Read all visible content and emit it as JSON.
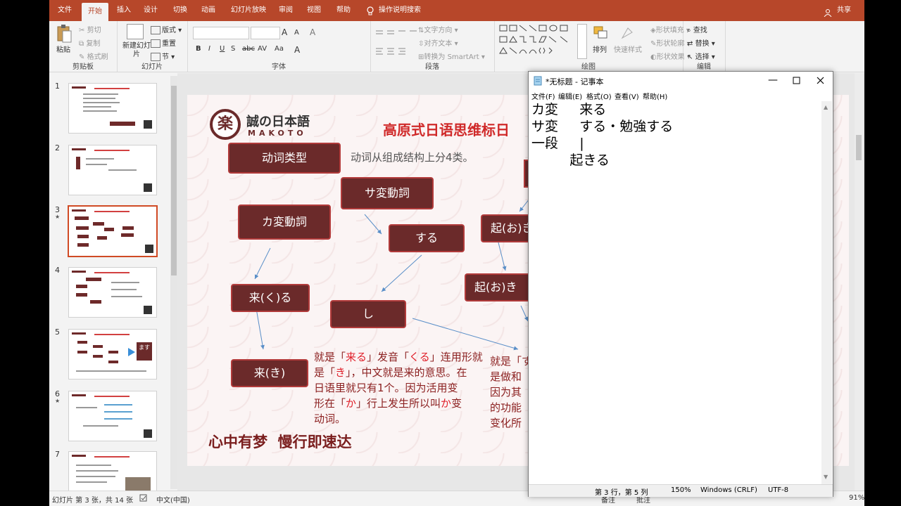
{
  "ppt": {
    "tabs": [
      "文件",
      "开始",
      "插入",
      "设计",
      "切换",
      "动画",
      "幻灯片放映",
      "审阅",
      "视图",
      "帮助"
    ],
    "active_tab": "开始",
    "tell_me": "操作说明搜索",
    "share": "共享",
    "groups": {
      "clipboard": {
        "label": "剪贴板",
        "paste": "粘贴",
        "cut": "剪切",
        "copy": "复制",
        "painter": "格式刷"
      },
      "slides": {
        "label": "幻灯片",
        "new": "新建幻灯片",
        "layout": "版式",
        "reset": "重置",
        "section": "节"
      },
      "font": {
        "label": "字体",
        "bold": "B",
        "italic": "I",
        "underline": "U",
        "strike": "S",
        "abc": "abc",
        "av": "AV",
        "aa": "Aa",
        "grow": "A",
        "shrink": "A",
        "clear": "A"
      },
      "paragraph": {
        "label": "段落",
        "text_direction": "文字方向",
        "align_text": "对齐文本",
        "smartart": "转换为 SmartArt"
      },
      "drawing": {
        "label": "绘图",
        "arrange": "排列",
        "quick_styles": "快速样式",
        "fill": "形状填充",
        "outline": "形状轮廓",
        "effects": "形状效果"
      },
      "editing": {
        "label": "编辑",
        "find": "查找",
        "replace": "替换",
        "select": "选择"
      }
    },
    "thumb_numbers": [
      "1",
      "2",
      "3",
      "4",
      "5",
      "6",
      "7"
    ],
    "thumb_star_5": "★",
    "thumb_star_6": "★",
    "thumb_5_badge": "ます",
    "status": {
      "slide": "幻灯片 第 3 张，共 14 张",
      "lang": "中文(中国)",
      "notes": "备注",
      "comments": "批注",
      "zoom": "91%"
    }
  },
  "slide": {
    "logo_glyph": "楽",
    "logo_text": "誠の日本語",
    "logo_sub": "MAKOTO",
    "title": "高原式日语思维标日",
    "intro": "动词从组成结构上分4类。",
    "boxes": {
      "type": "动词类型",
      "sa": "サ変動詞",
      "ka": "カ変動詞",
      "suru": "する",
      "oki_o": "起(お)き",
      "kuru": "来(く)る",
      "shi": "し",
      "oki_oki": "起(お)き",
      "ki": "来(き)"
    },
    "note_left": [
      "就是「",
      "来る",
      "」发音「",
      "くる",
      "」连用形就",
      "是「",
      "き",
      "」，中文就是来的意思。在",
      "日语里就只有1个。因为活用变",
      "形在「",
      "か",
      "」行上发生所以叫",
      "か",
      "变",
      "动词。"
    ],
    "note_right": [
      "就是「す",
      "是做和",
      "因为其",
      "的功能",
      "变化所"
    ],
    "slogan": "心中有梦  慢行即速达"
  },
  "notepad": {
    "title": "*无标题 - 记事本",
    "menu": [
      "文件(F)",
      "编辑(E)",
      "格式(O)",
      "查看(V)",
      "帮助(H)"
    ],
    "lines": [
      "カ変     来る",
      "サ変     する・勉強する",
      "一段     |",
      "         起きる"
    ],
    "status": {
      "pos": "第 3 行，第 5 列",
      "zoom": "150%",
      "eol": "Windows (CRLF)",
      "enc": "UTF-8"
    }
  },
  "colors": {
    "accent": "#b7472a",
    "box": "#6b2a2a",
    "note": "#8b1f1f",
    "highlight": "#e0202a"
  }
}
